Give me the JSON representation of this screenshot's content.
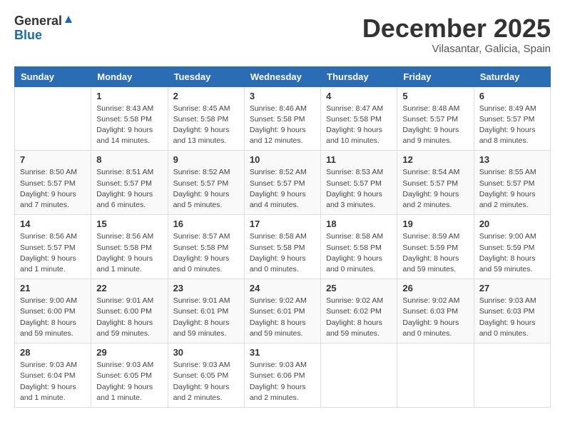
{
  "header": {
    "logo_general": "General",
    "logo_blue": "Blue",
    "title": "December 2025",
    "location": "Vilasantar, Galicia, Spain"
  },
  "weekdays": [
    "Sunday",
    "Monday",
    "Tuesday",
    "Wednesday",
    "Thursday",
    "Friday",
    "Saturday"
  ],
  "weeks": [
    [
      {
        "day": "",
        "info": ""
      },
      {
        "day": "1",
        "info": "Sunrise: 8:43 AM\nSunset: 5:58 PM\nDaylight: 9 hours\nand 14 minutes."
      },
      {
        "day": "2",
        "info": "Sunrise: 8:45 AM\nSunset: 5:58 PM\nDaylight: 9 hours\nand 13 minutes."
      },
      {
        "day": "3",
        "info": "Sunrise: 8:46 AM\nSunset: 5:58 PM\nDaylight: 9 hours\nand 12 minutes."
      },
      {
        "day": "4",
        "info": "Sunrise: 8:47 AM\nSunset: 5:58 PM\nDaylight: 9 hours\nand 10 minutes."
      },
      {
        "day": "5",
        "info": "Sunrise: 8:48 AM\nSunset: 5:57 PM\nDaylight: 9 hours\nand 9 minutes."
      },
      {
        "day": "6",
        "info": "Sunrise: 8:49 AM\nSunset: 5:57 PM\nDaylight: 9 hours\nand 8 minutes."
      }
    ],
    [
      {
        "day": "7",
        "info": "Sunrise: 8:50 AM\nSunset: 5:57 PM\nDaylight: 9 hours\nand 7 minutes."
      },
      {
        "day": "8",
        "info": "Sunrise: 8:51 AM\nSunset: 5:57 PM\nDaylight: 9 hours\nand 6 minutes."
      },
      {
        "day": "9",
        "info": "Sunrise: 8:52 AM\nSunset: 5:57 PM\nDaylight: 9 hours\nand 5 minutes."
      },
      {
        "day": "10",
        "info": "Sunrise: 8:52 AM\nSunset: 5:57 PM\nDaylight: 9 hours\nand 4 minutes."
      },
      {
        "day": "11",
        "info": "Sunrise: 8:53 AM\nSunset: 5:57 PM\nDaylight: 9 hours\nand 3 minutes."
      },
      {
        "day": "12",
        "info": "Sunrise: 8:54 AM\nSunset: 5:57 PM\nDaylight: 9 hours\nand 2 minutes."
      },
      {
        "day": "13",
        "info": "Sunrise: 8:55 AM\nSunset: 5:57 PM\nDaylight: 9 hours\nand 2 minutes."
      }
    ],
    [
      {
        "day": "14",
        "info": "Sunrise: 8:56 AM\nSunset: 5:57 PM\nDaylight: 9 hours\nand 1 minute."
      },
      {
        "day": "15",
        "info": "Sunrise: 8:56 AM\nSunset: 5:58 PM\nDaylight: 9 hours\nand 1 minute."
      },
      {
        "day": "16",
        "info": "Sunrise: 8:57 AM\nSunset: 5:58 PM\nDaylight: 9 hours\nand 0 minutes."
      },
      {
        "day": "17",
        "info": "Sunrise: 8:58 AM\nSunset: 5:58 PM\nDaylight: 9 hours\nand 0 minutes."
      },
      {
        "day": "18",
        "info": "Sunrise: 8:58 AM\nSunset: 5:58 PM\nDaylight: 9 hours\nand 0 minutes."
      },
      {
        "day": "19",
        "info": "Sunrise: 8:59 AM\nSunset: 5:59 PM\nDaylight: 8 hours\nand 59 minutes."
      },
      {
        "day": "20",
        "info": "Sunrise: 9:00 AM\nSunset: 5:59 PM\nDaylight: 8 hours\nand 59 minutes."
      }
    ],
    [
      {
        "day": "21",
        "info": "Sunrise: 9:00 AM\nSunset: 6:00 PM\nDaylight: 8 hours\nand 59 minutes."
      },
      {
        "day": "22",
        "info": "Sunrise: 9:01 AM\nSunset: 6:00 PM\nDaylight: 8 hours\nand 59 minutes."
      },
      {
        "day": "23",
        "info": "Sunrise: 9:01 AM\nSunset: 6:01 PM\nDaylight: 8 hours\nand 59 minutes."
      },
      {
        "day": "24",
        "info": "Sunrise: 9:02 AM\nSunset: 6:01 PM\nDaylight: 8 hours\nand 59 minutes."
      },
      {
        "day": "25",
        "info": "Sunrise: 9:02 AM\nSunset: 6:02 PM\nDaylight: 8 hours\nand 59 minutes."
      },
      {
        "day": "26",
        "info": "Sunrise: 9:02 AM\nSunset: 6:03 PM\nDaylight: 9 hours\nand 0 minutes."
      },
      {
        "day": "27",
        "info": "Sunrise: 9:03 AM\nSunset: 6:03 PM\nDaylight: 9 hours\nand 0 minutes."
      }
    ],
    [
      {
        "day": "28",
        "info": "Sunrise: 9:03 AM\nSunset: 6:04 PM\nDaylight: 9 hours\nand 1 minute."
      },
      {
        "day": "29",
        "info": "Sunrise: 9:03 AM\nSunset: 6:05 PM\nDaylight: 9 hours\nand 1 minute."
      },
      {
        "day": "30",
        "info": "Sunrise: 9:03 AM\nSunset: 6:05 PM\nDaylight: 9 hours\nand 2 minutes."
      },
      {
        "day": "31",
        "info": "Sunrise: 9:03 AM\nSunset: 6:06 PM\nDaylight: 9 hours\nand 2 minutes."
      },
      {
        "day": "",
        "info": ""
      },
      {
        "day": "",
        "info": ""
      },
      {
        "day": "",
        "info": ""
      }
    ]
  ]
}
